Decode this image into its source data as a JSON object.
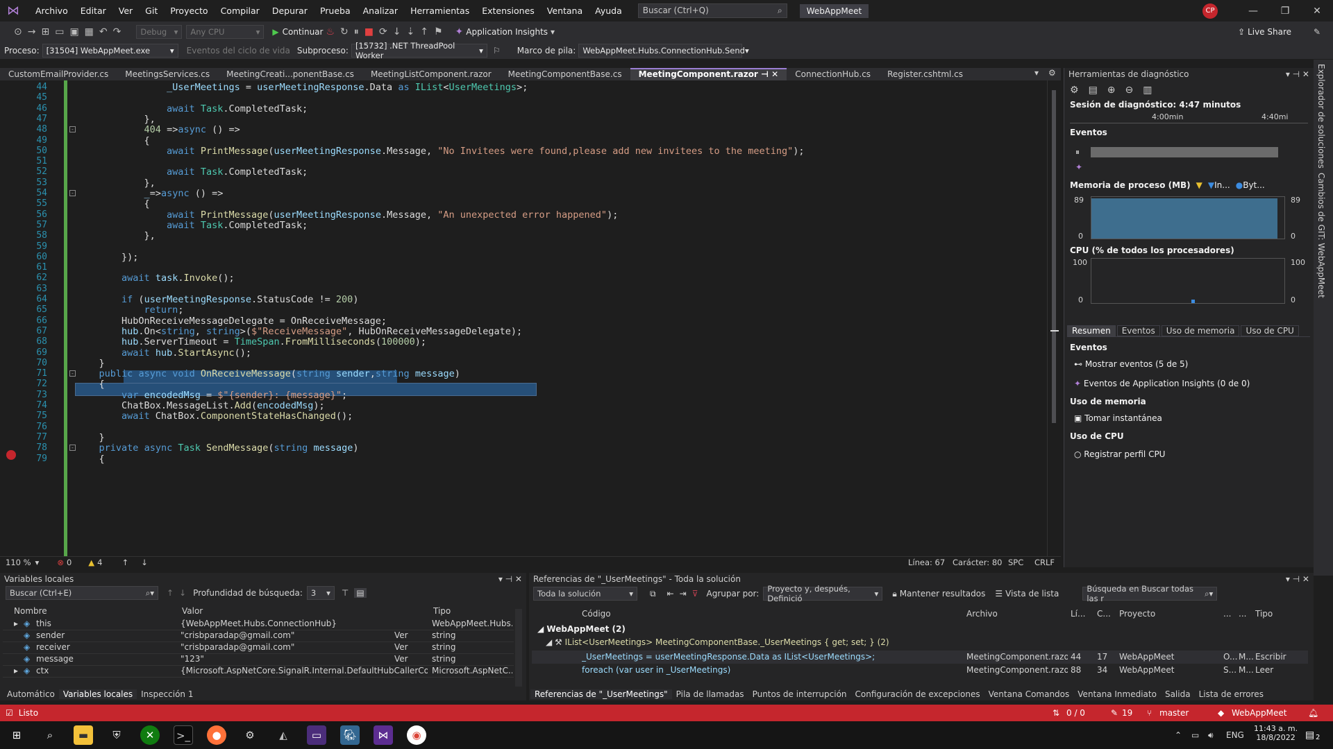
{
  "menu": [
    "Archivo",
    "Editar",
    "Ver",
    "Git",
    "Proyecto",
    "Compilar",
    "Depurar",
    "Prueba",
    "Analizar",
    "Herramientas",
    "Extensiones",
    "Ventana",
    "Ayuda"
  ],
  "search": {
    "placeholder": "Buscar (Ctrl+Q)"
  },
  "solution_title": "WebAppMeet",
  "user_initials": "CP",
  "toolbar": {
    "config": "Debug",
    "platform": "Any CPU",
    "continue_label": "Continuar",
    "app_insights": "Application Insights",
    "live_share": "Live Share"
  },
  "debug_toolbar": {
    "process_label": "Proceso:",
    "process_value": "[31504] WebAppMeet.exe",
    "lifecycle_label": "Eventos del ciclo de vida",
    "thread_label": "Subproceso:",
    "thread_value": "[15732] .NET ThreadPool Worker",
    "stack_label": "Marco de pila:",
    "stack_value": "WebAppMeet.Hubs.ConnectionHub.Send"
  },
  "tabs": [
    {
      "label": "CustomEmailProvider.cs",
      "active": false
    },
    {
      "label": "MeetingsServices.cs",
      "active": false
    },
    {
      "label": "MeetingCreati...ponentBase.cs",
      "active": false
    },
    {
      "label": "MeetingListComponent.razor",
      "active": false
    },
    {
      "label": "MeetingComponentBase.cs",
      "active": false
    },
    {
      "label": "MeetingComponent.razor",
      "active": true
    },
    {
      "label": "ConnectionHub.cs",
      "active": false
    },
    {
      "label": "Register.cshtml.cs",
      "active": false
    }
  ],
  "code_lines": [
    {
      "n": "44",
      "t": "                _UserMeetings = userMeetingResponse.Data as IList<UserMeetings>;"
    },
    {
      "n": "45",
      "t": ""
    },
    {
      "n": "46",
      "t": "                await Task.CompletedTask;"
    },
    {
      "n": "47",
      "t": "            },"
    },
    {
      "n": "48",
      "t": "            404 =>async () =>"
    },
    {
      "n": "49",
      "t": "            {"
    },
    {
      "n": "50",
      "t": "                await PrintMessage(userMeetingResponse.Message, \"No Invitees were found,please add new invitees to the meeting\");"
    },
    {
      "n": "51",
      "t": ""
    },
    {
      "n": "52",
      "t": "                await Task.CompletedTask;"
    },
    {
      "n": "53",
      "t": "            },"
    },
    {
      "n": "54",
      "t": "            _=>async () =>"
    },
    {
      "n": "55",
      "t": "            {"
    },
    {
      "n": "56",
      "t": "                await PrintMessage(userMeetingResponse.Message, \"An unexpected error happened\");"
    },
    {
      "n": "57",
      "t": "                await Task.CompletedTask;"
    },
    {
      "n": "58",
      "t": "            },"
    },
    {
      "n": "59",
      "t": ""
    },
    {
      "n": "60",
      "t": "        });"
    },
    {
      "n": "61",
      "t": ""
    },
    {
      "n": "62",
      "t": "        await task.Invoke();"
    },
    {
      "n": "63",
      "t": ""
    },
    {
      "n": "64",
      "t": "        if (userMeetingResponse.StatusCode != 200)"
    },
    {
      "n": "65",
      "t": "            return;"
    },
    {
      "n": "66",
      "t": "        HubOnReceiveMessageDelegate = OnReceiveMessage;"
    },
    {
      "n": "67",
      "t": "        hub.On<string, string>($\"ReceiveMessage\", HubOnReceiveMessageDelegate);"
    },
    {
      "n": "68",
      "t": "        hub.ServerTimeout = TimeSpan.FromMilliseconds(100000);"
    },
    {
      "n": "69",
      "t": "        await hub.StartAsync();"
    },
    {
      "n": "70",
      "t": "    }"
    },
    {
      "n": "71",
      "t": "    public async void OnReceiveMessage(string sender,string message)"
    },
    {
      "n": "72",
      "t": "    {"
    },
    {
      "n": "73",
      "t": "        var encodedMsg = $\"{sender}: {message}\";"
    },
    {
      "n": "74",
      "t": "        ChatBox.MessageList.Add(encodedMsg);"
    },
    {
      "n": "75",
      "t": "        await ChatBox.ComponentStateHasChanged();"
    },
    {
      "n": "76",
      "t": ""
    },
    {
      "n": "77",
      "t": "    }"
    },
    {
      "n": "78",
      "t": "    private async Task SendMessage(string message)"
    },
    {
      "n": "79",
      "t": "    {"
    }
  ],
  "editor_status": {
    "zoom": "110 %",
    "errors": "0",
    "warnings": "4",
    "line": "Línea: 67",
    "char": "Carácter: 80",
    "spc": "SPC",
    "eol": "CRLF"
  },
  "diagnostics": {
    "title": "Herramientas de diagnóstico",
    "session": "Sesión de diagnóstico: 4:47 minutos",
    "time_a": "4:00min",
    "time_b": "4:40mi",
    "events_header": "Eventos",
    "memory_header": "Memoria de proceso (MB)",
    "memory_legend_a": "In...",
    "memory_legend_b": "Byt...",
    "mem_max": "89",
    "mem_min": "0",
    "cpu_header": "CPU (% de todos los procesadores)",
    "cpu_max": "100",
    "cpu_min": "0",
    "tabs": [
      "Resumen",
      "Eventos",
      "Uso de memoria",
      "Uso de CPU"
    ],
    "sec_events": "Eventos",
    "show_events": "Mostrar eventos (5 de 5)",
    "ai_events": "Eventos de Application Insights (0 de 0)",
    "sec_memory": "Uso de memoria",
    "snapshot": "Tomar instantánea",
    "sec_cpu": "Uso de CPU",
    "cpu_profile": "Registrar perfil CPU"
  },
  "sidebar": [
    "Explorador de soluciones",
    "Cambios de GIT: WebAppMeet"
  ],
  "locals": {
    "title": "Variables locales",
    "search_placeholder": "Buscar (Ctrl+E)",
    "depth_label": "Profundidad de búsqueda:",
    "depth_value": "3",
    "cols": [
      "Nombre",
      "Valor",
      "Tipo"
    ],
    "rows": [
      {
        "name": "this",
        "value": "{WebAppMeet.Hubs.ConnectionHub}",
        "type": "WebAppMeet.Hubs...",
        "view": ""
      },
      {
        "name": "sender",
        "value": "\"crisbparadap@gmail.com\"",
        "type": "string",
        "view": "Ver"
      },
      {
        "name": "receiver",
        "value": "\"crisbparadap@gmail.com\"",
        "type": "string",
        "view": "Ver"
      },
      {
        "name": "message",
        "value": "\"123\"",
        "type": "string",
        "view": "Ver"
      },
      {
        "name": "ctx",
        "value": "{Microsoft.AspNetCore.SignalR.Internal.DefaultHubCallerContext}",
        "type": "Microsoft.AspNetC...",
        "view": ""
      }
    ],
    "tabs": [
      "Automático",
      "Variables locales",
      "Inspección 1"
    ]
  },
  "refs": {
    "title": "Referencias de \"_UserMeetings\" - Toda la solución",
    "scope": "Toda la solución",
    "group_label": "Agrupar por:",
    "group_value": "Proyecto y, después, Definició",
    "keep": "Mantener resultados",
    "list_view": "Vista de lista",
    "search": "Búsqueda en Buscar todas las r",
    "cols": [
      "Código",
      "Archivo",
      "Lí...",
      "C...",
      "Proyecto",
      "...",
      "...",
      "Tipo"
    ],
    "group": "WebAppMeet (2)",
    "def": "IList<UserMeetings> MeetingComponentBase._UserMeetings { get; set; } (2)",
    "rows": [
      {
        "code": "_UserMeetings = userMeetingResponse.Data as IList<UserMeetings>;",
        "file": "MeetingComponent.razor",
        "line": "44",
        "col": "17",
        "project": "WebAppMeet",
        "a": "O...",
        "b": "M...",
        "type": "Escribir"
      },
      {
        "code": "foreach (var user in _UserMeetings)",
        "file": "MeetingComponent.razor",
        "line": "88",
        "col": "34",
        "project": "WebAppMeet",
        "a": "S...",
        "b": "M...",
        "type": "Leer"
      }
    ],
    "tabs": [
      "Referencias de \"_UserMeetings\"",
      "Pila de llamadas",
      "Puntos de interrupción",
      "Configuración de excepciones",
      "Ventana Comandos",
      "Ventana Inmediato",
      "Salida",
      "Lista de errores"
    ]
  },
  "status": {
    "ready": "Listo",
    "updown": "0 / 0",
    "edits": "19",
    "branch": "master",
    "repo": "WebAppMeet"
  },
  "taskbar": {
    "lang": "ENG",
    "time": "11:43 a. m.",
    "date": "18/8/2022",
    "notif": "2"
  }
}
